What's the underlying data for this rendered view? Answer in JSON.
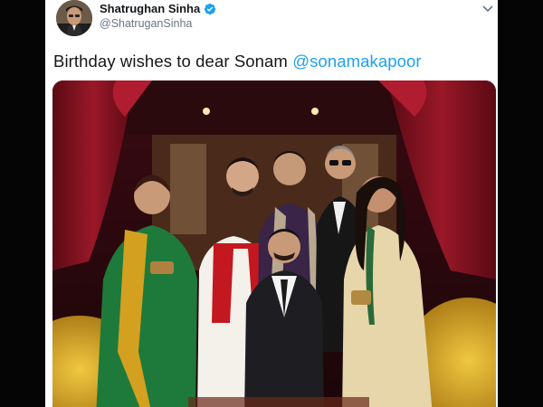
{
  "tweet": {
    "author": {
      "display_name": "Shatrughan Sinha",
      "handle": "@ShatruganSinha",
      "verified": true,
      "avatar_icon": "avatar-portrait"
    },
    "text": "Birthday wishes to dear Sonam",
    "mention": "@sonamakapoor",
    "photo": {
      "description_icon": "group-photo",
      "dominant_colors": [
        "#7a1020",
        "#d4a020",
        "#1a7a3a",
        "#e8d8b0",
        "#1a1a1a"
      ]
    }
  },
  "colors": {
    "link": "#1da1f2",
    "text": "#14171a",
    "secondary": "#657786",
    "verified": "#1da1f2"
  }
}
